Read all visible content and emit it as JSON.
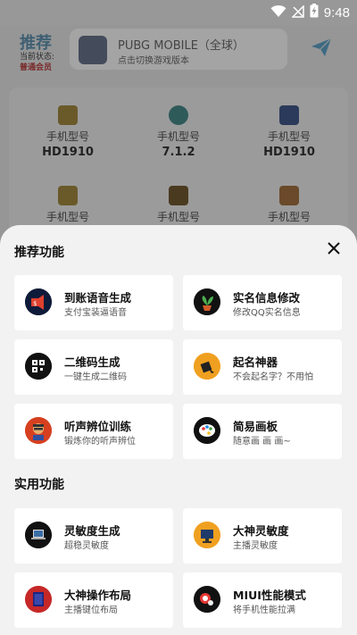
{
  "status_bar": {
    "time": "9:48"
  },
  "background_app": {
    "title": "推荐",
    "state_label": "当前状态:",
    "state_value": "普通会员",
    "game": {
      "name": "PUBG MOBILE（全球）",
      "subtitle": "点击切换游戏版本"
    },
    "info_cells": [
      {
        "label": "手机型号",
        "value": "HD1910"
      },
      {
        "label": "手机型号",
        "value": "7.1.2"
      },
      {
        "label": "手机型号",
        "value": "HD1910"
      },
      {
        "label": "手机型号",
        "value": ""
      },
      {
        "label": "手机型号",
        "value": ""
      },
      {
        "label": "手机型号",
        "value": ""
      }
    ]
  },
  "sheet": {
    "section1_title": "推荐功能",
    "section2_title": "实用功能",
    "close_icon": "close-icon",
    "recommended": [
      {
        "title": "到账语音生成",
        "sub": "支付宝装逼语音",
        "icon": "speaker-money-icon"
      },
      {
        "title": "实名信息修改",
        "sub": "修改QQ实名信息",
        "icon": "plant-icon"
      },
      {
        "title": "二维码生成",
        "sub": "一键生成二维码",
        "icon": "qrcode-icon"
      },
      {
        "title": "起名神器",
        "sub": "不会起名字？不用怕",
        "icon": "pen-icon"
      },
      {
        "title": "听声辨位训练",
        "sub": "锻炼你的听声辨位",
        "icon": "soldier-icon"
      },
      {
        "title": "简易画板",
        "sub": "随意画 画 画~",
        "icon": "palette-icon"
      }
    ],
    "practical": [
      {
        "title": "灵敏度生成",
        "sub": "超稳灵敏度",
        "icon": "laptop-icon"
      },
      {
        "title": "大神灵敏度",
        "sub": "主播灵敏度",
        "icon": "monitor-icon"
      },
      {
        "title": "大神操作布局",
        "sub": "主播键位布局",
        "icon": "tablet-icon"
      },
      {
        "title": "MIUI性能模式",
        "sub": "将手机性能拉满",
        "icon": "gauge-icon"
      }
    ]
  }
}
